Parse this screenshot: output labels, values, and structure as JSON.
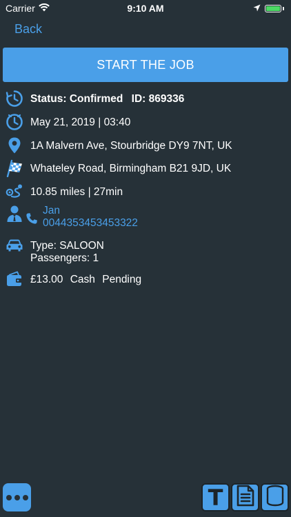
{
  "status_bar": {
    "carrier": "Carrier",
    "time": "9:10 AM",
    "battery_level": 1.0
  },
  "nav": {
    "back_label": "Back"
  },
  "actions": {
    "start_label": "START THE JOB"
  },
  "job": {
    "status": "Status: Confirmed",
    "id": "ID: 869336",
    "datetime": "May 21, 2019 | 03:40",
    "pickup": "1A Malvern Ave, Stourbridge DY9 7NT, UK",
    "dropoff": "Whateley Road, Birmingham B21 9JD, UK",
    "distance": "10.85 miles | 27min",
    "customer_name": "Jan",
    "customer_phone": "0044353453453322",
    "vehicle_type": "Type: SALOON",
    "passengers": "Passengers: 1",
    "price": "£13.00",
    "payment_method": "Cash",
    "payment_status": "Pending"
  },
  "toolbar": {
    "t_label": "T"
  },
  "colors": {
    "background": "#263138",
    "accent": "#4a9fe8",
    "text": "#ffffff"
  },
  "icons": {
    "status": "clock-history-icon",
    "datetime": "clock-icon",
    "pickup": "map-pin-icon",
    "dropoff": "checkered-flag-icon",
    "distance": "route-icon",
    "customer": "person-icon",
    "phone": "phone-icon",
    "vehicle": "car-icon",
    "payment": "wallet-icon",
    "more": "ellipsis-icon",
    "document": "document-icon",
    "coins": "coins-icon"
  }
}
